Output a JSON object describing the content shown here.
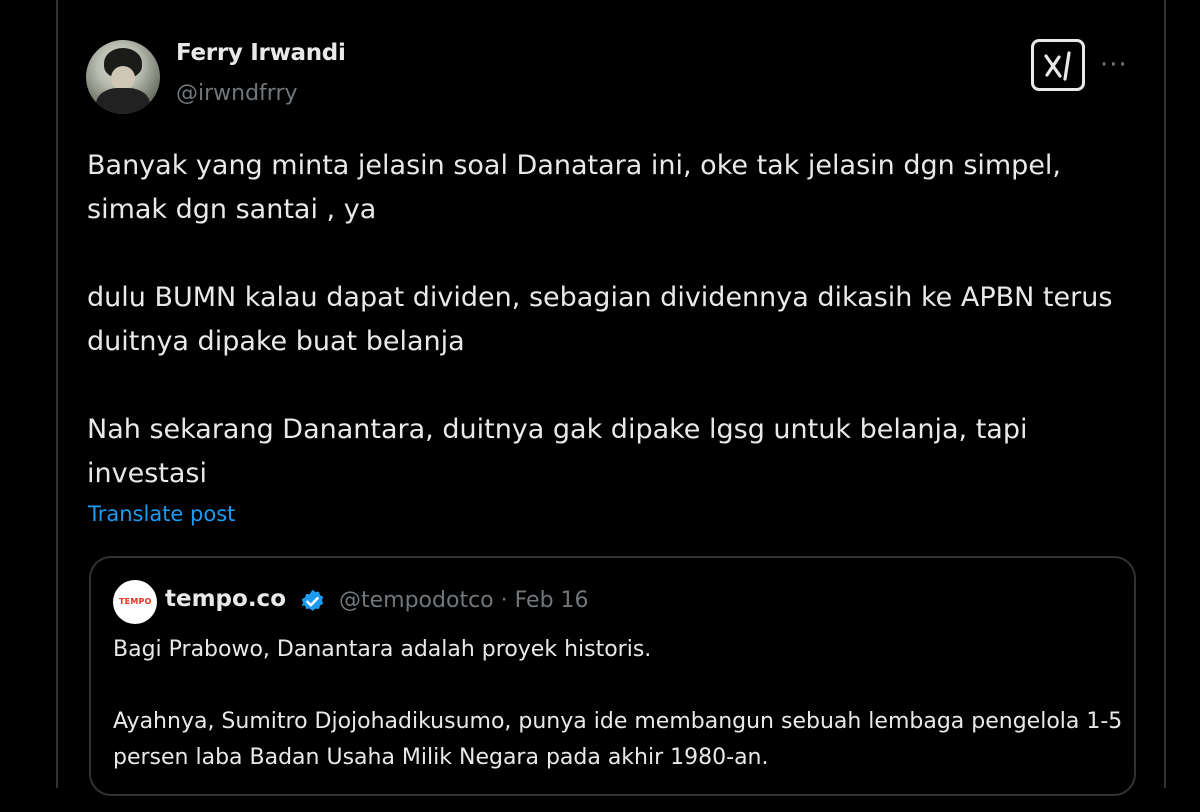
{
  "post": {
    "author": {
      "display_name": "Ferry Irwandi",
      "handle": "@irwndfrry",
      "avatar_icon": "profile-photo"
    },
    "grok_icon": "grok-icon",
    "more_label": "···",
    "paragraphs": [
      "Banyak yang minta jelasin soal Danatara ini, oke tak jelasin dgn simpel, simak dgn santai , ya",
      "dulu BUMN kalau dapat dividen, sebagian dividennya dikasih ke APBN terus duitnya dipake buat belanja",
      "Nah sekarang Danantara, duitnya gak dipake lgsg untuk belanja, tapi investasi"
    ],
    "translate_label": "Translate post"
  },
  "quote": {
    "avatar_text": "TEMPO",
    "name": "tempo.co",
    "verified_icon": "verified-badge-icon",
    "meta": "@tempodotco · Feb 16",
    "paragraphs": [
      "Bagi Prabowo, Danantara adalah proyek historis.",
      "Ayahnya, Sumitro Djojohadikusumo, punya ide membangun sebuah lembaga pengelola 1-5 persen laba Badan Usaha Milik Negara pada akhir 1980-an."
    ]
  },
  "colors": {
    "background": "#000000",
    "text_primary": "#e7e9ea",
    "text_secondary": "#71767b",
    "link": "#1d9bf0",
    "border": "#2f3336",
    "verified": "#1d9bf0"
  }
}
